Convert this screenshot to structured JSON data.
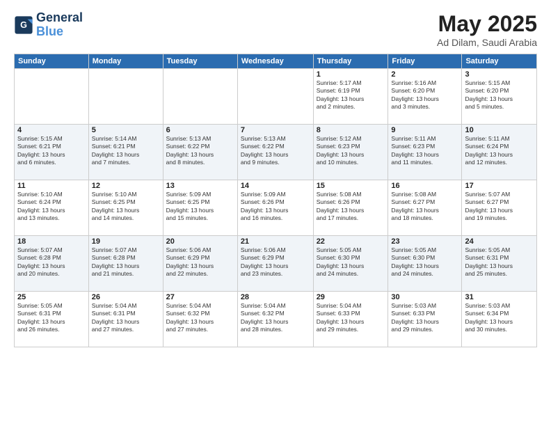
{
  "header": {
    "logo_line1": "General",
    "logo_line2": "Blue",
    "month": "May 2025",
    "location": "Ad Dilam, Saudi Arabia"
  },
  "days_of_week": [
    "Sunday",
    "Monday",
    "Tuesday",
    "Wednesday",
    "Thursday",
    "Friday",
    "Saturday"
  ],
  "weeks": [
    [
      {
        "day": "",
        "info": ""
      },
      {
        "day": "",
        "info": ""
      },
      {
        "day": "",
        "info": ""
      },
      {
        "day": "",
        "info": ""
      },
      {
        "day": "1",
        "info": "Sunrise: 5:17 AM\nSunset: 6:19 PM\nDaylight: 13 hours\nand 2 minutes."
      },
      {
        "day": "2",
        "info": "Sunrise: 5:16 AM\nSunset: 6:20 PM\nDaylight: 13 hours\nand 3 minutes."
      },
      {
        "day": "3",
        "info": "Sunrise: 5:15 AM\nSunset: 6:20 PM\nDaylight: 13 hours\nand 5 minutes."
      }
    ],
    [
      {
        "day": "4",
        "info": "Sunrise: 5:15 AM\nSunset: 6:21 PM\nDaylight: 13 hours\nand 6 minutes."
      },
      {
        "day": "5",
        "info": "Sunrise: 5:14 AM\nSunset: 6:21 PM\nDaylight: 13 hours\nand 7 minutes."
      },
      {
        "day": "6",
        "info": "Sunrise: 5:13 AM\nSunset: 6:22 PM\nDaylight: 13 hours\nand 8 minutes."
      },
      {
        "day": "7",
        "info": "Sunrise: 5:13 AM\nSunset: 6:22 PM\nDaylight: 13 hours\nand 9 minutes."
      },
      {
        "day": "8",
        "info": "Sunrise: 5:12 AM\nSunset: 6:23 PM\nDaylight: 13 hours\nand 10 minutes."
      },
      {
        "day": "9",
        "info": "Sunrise: 5:11 AM\nSunset: 6:23 PM\nDaylight: 13 hours\nand 11 minutes."
      },
      {
        "day": "10",
        "info": "Sunrise: 5:11 AM\nSunset: 6:24 PM\nDaylight: 13 hours\nand 12 minutes."
      }
    ],
    [
      {
        "day": "11",
        "info": "Sunrise: 5:10 AM\nSunset: 6:24 PM\nDaylight: 13 hours\nand 13 minutes."
      },
      {
        "day": "12",
        "info": "Sunrise: 5:10 AM\nSunset: 6:25 PM\nDaylight: 13 hours\nand 14 minutes."
      },
      {
        "day": "13",
        "info": "Sunrise: 5:09 AM\nSunset: 6:25 PM\nDaylight: 13 hours\nand 15 minutes."
      },
      {
        "day": "14",
        "info": "Sunrise: 5:09 AM\nSunset: 6:26 PM\nDaylight: 13 hours\nand 16 minutes."
      },
      {
        "day": "15",
        "info": "Sunrise: 5:08 AM\nSunset: 6:26 PM\nDaylight: 13 hours\nand 17 minutes."
      },
      {
        "day": "16",
        "info": "Sunrise: 5:08 AM\nSunset: 6:27 PM\nDaylight: 13 hours\nand 18 minutes."
      },
      {
        "day": "17",
        "info": "Sunrise: 5:07 AM\nSunset: 6:27 PM\nDaylight: 13 hours\nand 19 minutes."
      }
    ],
    [
      {
        "day": "18",
        "info": "Sunrise: 5:07 AM\nSunset: 6:28 PM\nDaylight: 13 hours\nand 20 minutes."
      },
      {
        "day": "19",
        "info": "Sunrise: 5:07 AM\nSunset: 6:28 PM\nDaylight: 13 hours\nand 21 minutes."
      },
      {
        "day": "20",
        "info": "Sunrise: 5:06 AM\nSunset: 6:29 PM\nDaylight: 13 hours\nand 22 minutes."
      },
      {
        "day": "21",
        "info": "Sunrise: 5:06 AM\nSunset: 6:29 PM\nDaylight: 13 hours\nand 23 minutes."
      },
      {
        "day": "22",
        "info": "Sunrise: 5:05 AM\nSunset: 6:30 PM\nDaylight: 13 hours\nand 24 minutes."
      },
      {
        "day": "23",
        "info": "Sunrise: 5:05 AM\nSunset: 6:30 PM\nDaylight: 13 hours\nand 24 minutes."
      },
      {
        "day": "24",
        "info": "Sunrise: 5:05 AM\nSunset: 6:31 PM\nDaylight: 13 hours\nand 25 minutes."
      }
    ],
    [
      {
        "day": "25",
        "info": "Sunrise: 5:05 AM\nSunset: 6:31 PM\nDaylight: 13 hours\nand 26 minutes."
      },
      {
        "day": "26",
        "info": "Sunrise: 5:04 AM\nSunset: 6:31 PM\nDaylight: 13 hours\nand 27 minutes."
      },
      {
        "day": "27",
        "info": "Sunrise: 5:04 AM\nSunset: 6:32 PM\nDaylight: 13 hours\nand 27 minutes."
      },
      {
        "day": "28",
        "info": "Sunrise: 5:04 AM\nSunset: 6:32 PM\nDaylight: 13 hours\nand 28 minutes."
      },
      {
        "day": "29",
        "info": "Sunrise: 5:04 AM\nSunset: 6:33 PM\nDaylight: 13 hours\nand 29 minutes."
      },
      {
        "day": "30",
        "info": "Sunrise: 5:03 AM\nSunset: 6:33 PM\nDaylight: 13 hours\nand 29 minutes."
      },
      {
        "day": "31",
        "info": "Sunrise: 5:03 AM\nSunset: 6:34 PM\nDaylight: 13 hours\nand 30 minutes."
      }
    ]
  ]
}
